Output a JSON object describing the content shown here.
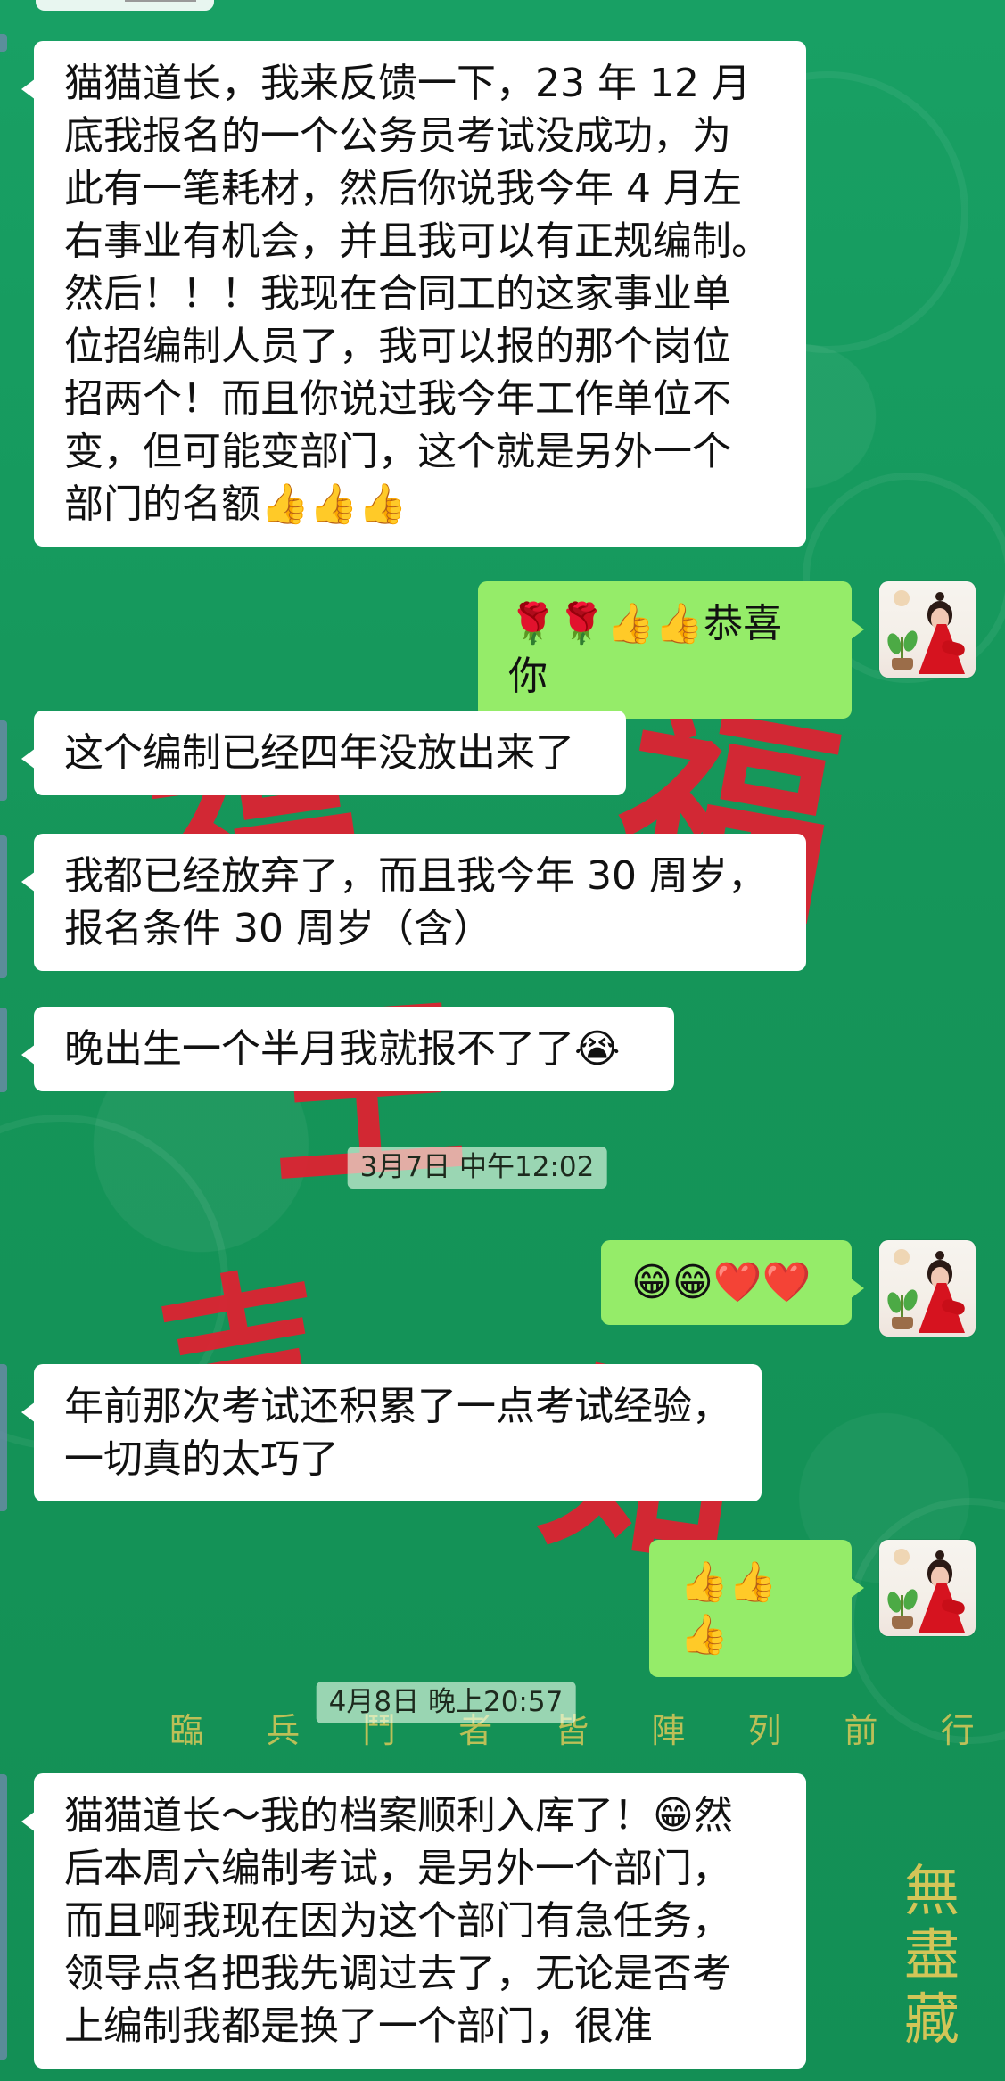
{
  "chat": {
    "messages": [
      {
        "text": "猫猫道长，我来反馈一下，23 年 12 月\n底我报名的一个公务员考试没成功，为\n此有一笔耗材，然后你说我今年 4 月左\n右事业有机会，并且我可以有正规编制。\n然后！！！我现在合同工的这家事业单\n位招编制人员了，我可以报的那个岗位\n招两个！而且你说过我今年工作单位不\n变，但可能变部门，这个就是另外一个\n部门的名额👍👍👍"
      },
      {
        "text": "🌹🌹👍👍恭喜你"
      },
      {
        "text": "这个编制已经四年没放出来了"
      },
      {
        "text": "我都已经放弃了，而且我今年 30 周岁，\n报名条件 30 周岁（含）"
      },
      {
        "text": "晚出生一个半月我就报不了了😭"
      },
      {
        "text": "😁😁❤️❤️"
      },
      {
        "text": "年前那次考试还积累了一点考试经验，\n一切真的太巧了"
      },
      {
        "text": "👍👍👍"
      },
      {
        "text": "猫猫道长～我的档案顺利入库了！😁然\n后本周六编制考试，是另外一个部门，\n而且啊我现在因为这个部门有急任务，\n领导点名把我先调过去了，无论是否考\n上编制我都是换了一个部门，很准"
      }
    ],
    "timestamps": [
      "3月7日 中午12:02",
      "4月8日 晚上20:57"
    ]
  },
  "background": {
    "red_glyphs": [
      "福",
      "福",
      "王",
      "吉",
      "如"
    ],
    "gold_line": "臨 兵 鬥 者 皆 陣 列 前 行",
    "gold_vertical": "無\n盡\n藏"
  },
  "colors": {
    "incoming_bubble": "#ffffff",
    "outgoing_bubble": "#95ec69",
    "background": "#16985f"
  },
  "icons": {
    "avatar": "avatar-icon"
  }
}
